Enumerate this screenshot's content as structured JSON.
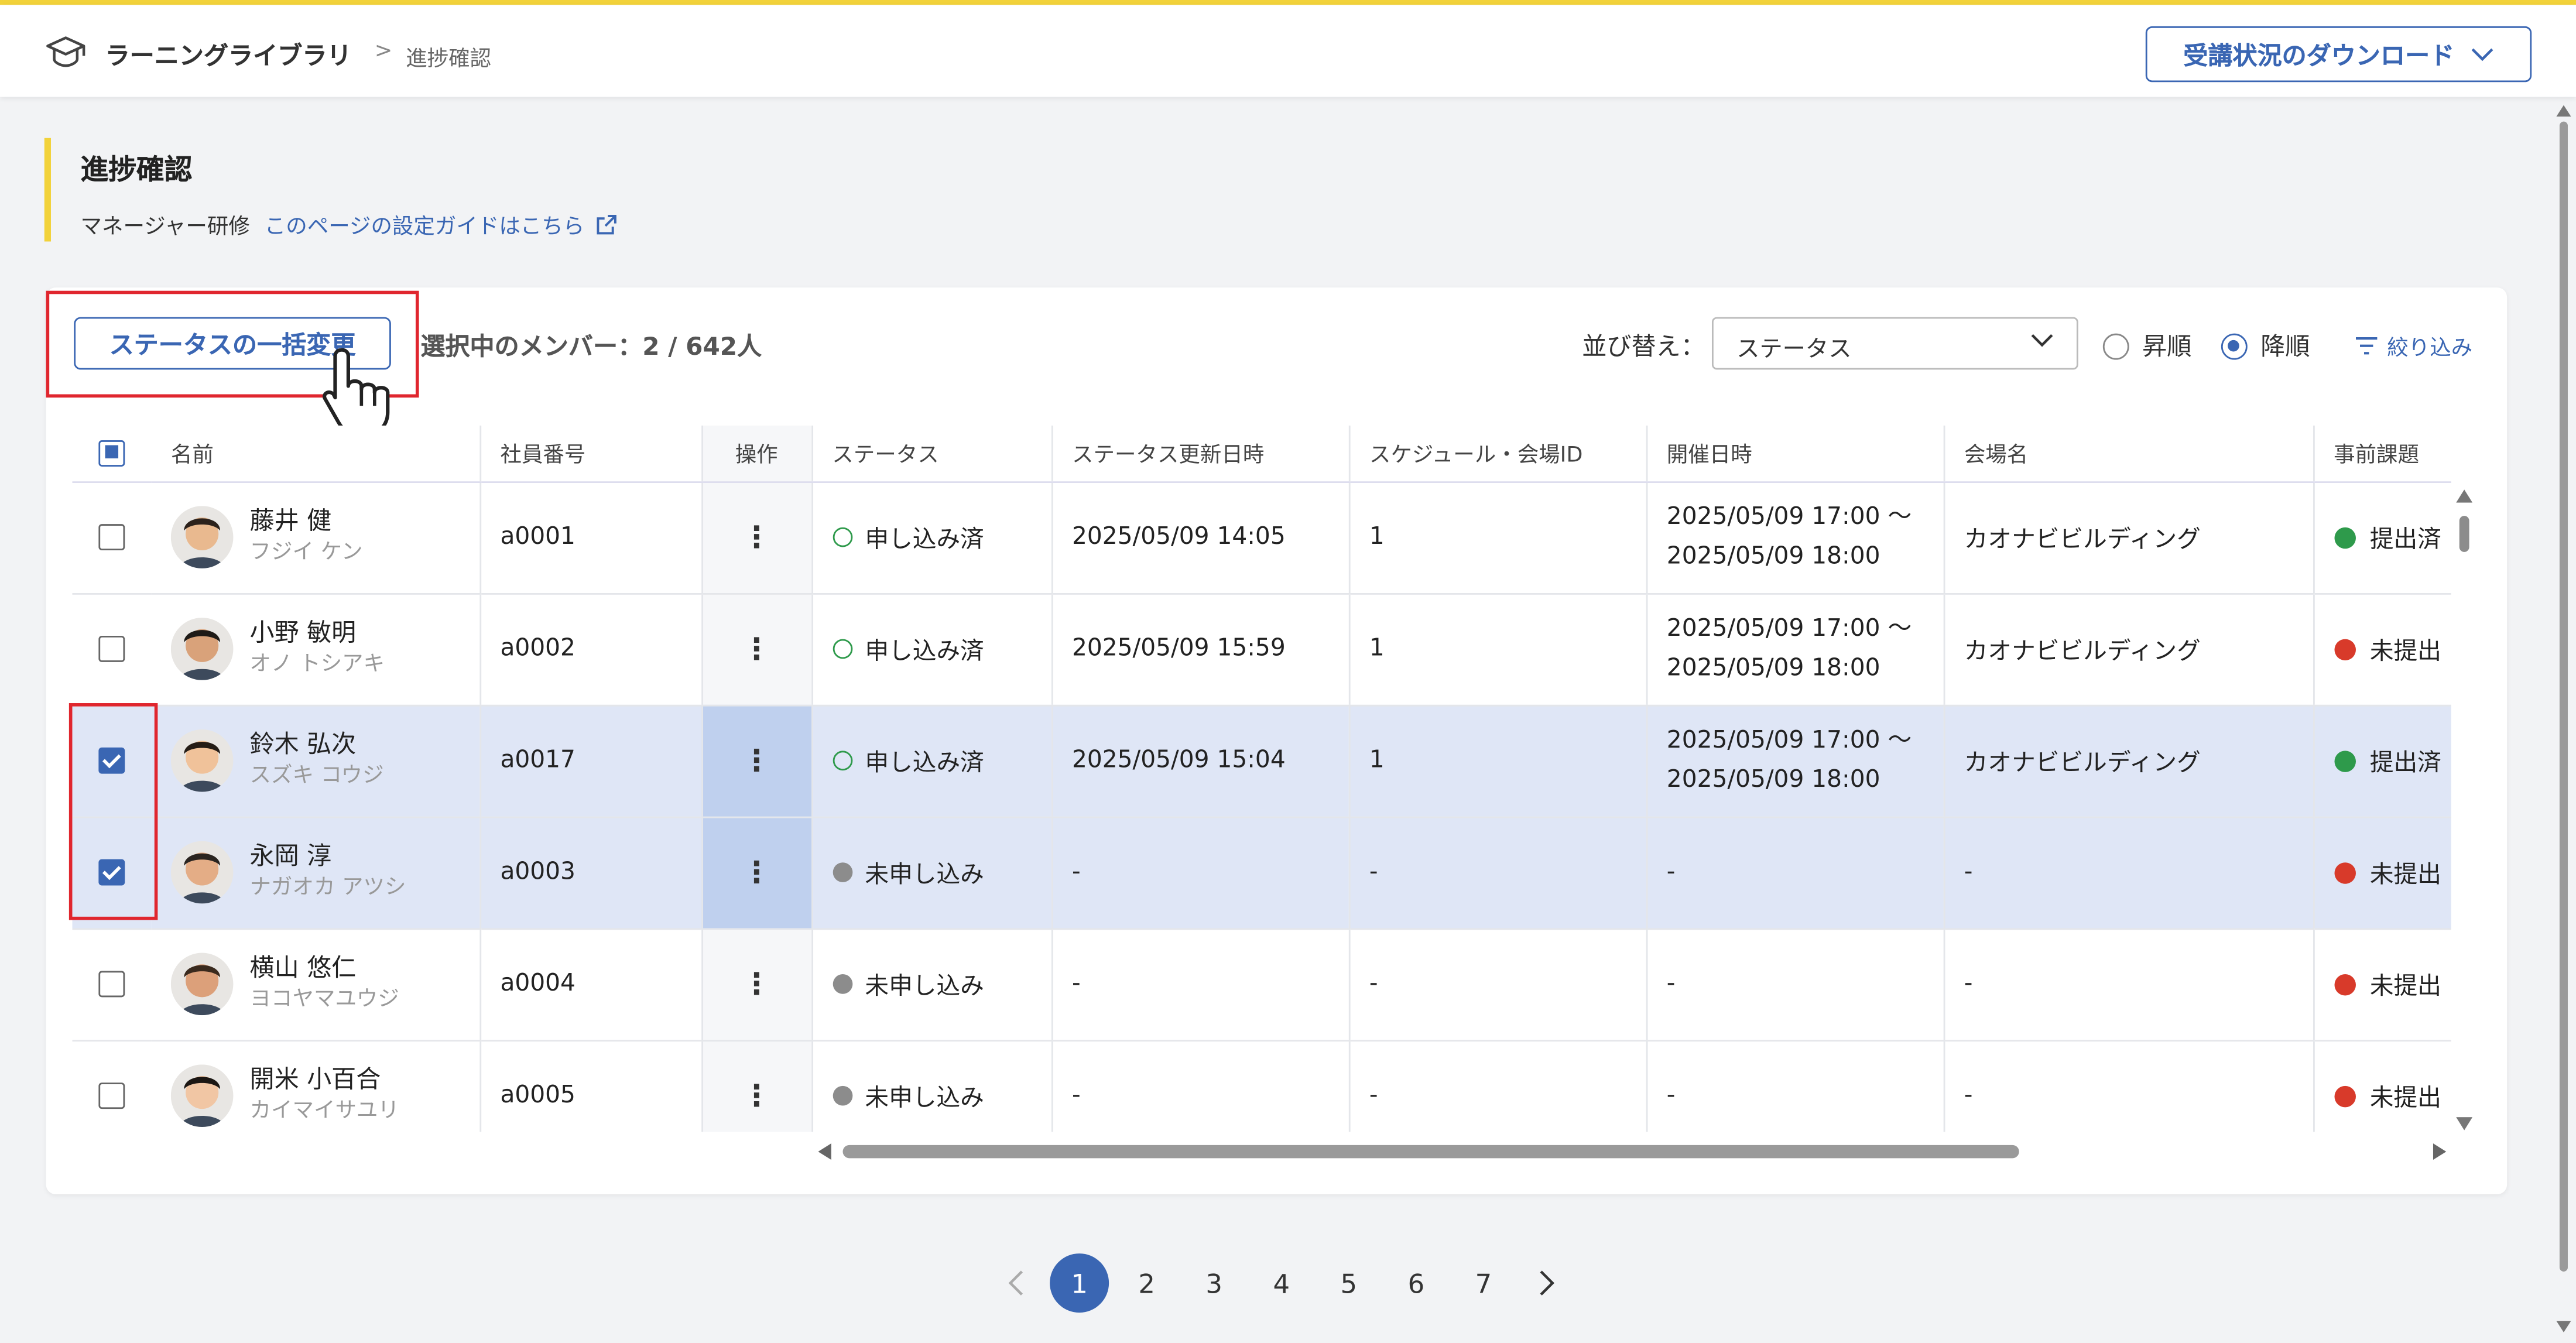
{
  "header": {
    "breadcrumb_root": "ラーニングライブラリ",
    "breadcrumb_sep": ">",
    "breadcrumb_current": "進捗確認",
    "download_button": "受講状況のダウンロード"
  },
  "page": {
    "title": "進捗確認",
    "course_label": "マネージャー研修",
    "guide_link": "このページの設定ガイドはこちら"
  },
  "toolbar": {
    "bulk_change_button": "ステータスの一括変更",
    "selected_count": "選択中のメンバー：2 / 642人",
    "sort_label": "並び替え：",
    "sort_value": "ステータス",
    "asc_label": "昇順",
    "desc_label": "降順",
    "sort_order": "desc",
    "filter_label": "絞り込み"
  },
  "table": {
    "columns": [
      "名前",
      "社員番号",
      "操作",
      "ステータス",
      "ステータス更新日時",
      "スケジュール・会場ID",
      "開催日時",
      "会場名",
      "事前課題"
    ],
    "rows": [
      {
        "selected": false,
        "name": "藤井 健",
        "kana": "フジイ ケン",
        "emp_no": "a0001",
        "menu": "⋮",
        "status": "申し込み済",
        "updated": "2025/05/09 14:05",
        "schedule_id": "1",
        "date_from": "2025/05/09 17:00 〜",
        "date_to": "2025/05/09 18:00",
        "venue": "カオナビビルディング",
        "task": "提出済"
      },
      {
        "selected": false,
        "name": "小野 敏明",
        "kana": "オノ トシアキ",
        "emp_no": "a0002",
        "menu": "⋮",
        "status": "申し込み済",
        "updated": "2025/05/09 15:59",
        "schedule_id": "1",
        "date_from": "2025/05/09 17:00 〜",
        "date_to": "2025/05/09 18:00",
        "venue": "カオナビビルディング",
        "task": "未提出"
      },
      {
        "selected": true,
        "name": "鈴木 弘次",
        "kana": "スズキ コウジ",
        "emp_no": "a0017",
        "menu": "⋮",
        "status": "申し込み済",
        "updated": "2025/05/09 15:04",
        "schedule_id": "1",
        "date_from": "2025/05/09 17:00 〜",
        "date_to": "2025/05/09 18:00",
        "venue": "カオナビビルディング",
        "task": "提出済"
      },
      {
        "selected": true,
        "name": "永岡 淳",
        "kana": "ナガオカ アツシ",
        "emp_no": "a0003",
        "menu": "⋮",
        "status": "未申し込み",
        "updated": "-",
        "schedule_id": "-",
        "date_from": "-",
        "date_to": "",
        "venue": "-",
        "task": "未提出"
      },
      {
        "selected": false,
        "name": "横山 悠仁",
        "kana": "ヨコヤマユウジ",
        "emp_no": "a0004",
        "menu": "⋮",
        "status": "未申し込み",
        "updated": "-",
        "schedule_id": "-",
        "date_from": "-",
        "date_to": "",
        "venue": "-",
        "task": "未提出"
      },
      {
        "selected": false,
        "name": "開米 小百合",
        "kana": "カイマイサユリ",
        "emp_no": "a0005",
        "menu": "⋮",
        "status": "未申し込み",
        "updated": "-",
        "schedule_id": "-",
        "date_from": "-",
        "date_to": "",
        "venue": "-",
        "task": "未提出"
      }
    ]
  },
  "pagination": {
    "pages": [
      "1",
      "2",
      "3",
      "4",
      "5",
      "6",
      "7"
    ],
    "current": "1"
  },
  "colors": {
    "accent": "#3a66b3",
    "highlight_yellow": "#f2d23a",
    "annotation_red": "#e0262e",
    "submitted_green": "#2e9a4b",
    "not_submitted_red": "#d83a2a",
    "selected_row": "#dfe6f6"
  },
  "icons": {
    "logo": "graduation-cap-icon",
    "external_link": "external-link-icon",
    "filter": "filter-icon",
    "cursor": "hand-pointer-icon"
  }
}
